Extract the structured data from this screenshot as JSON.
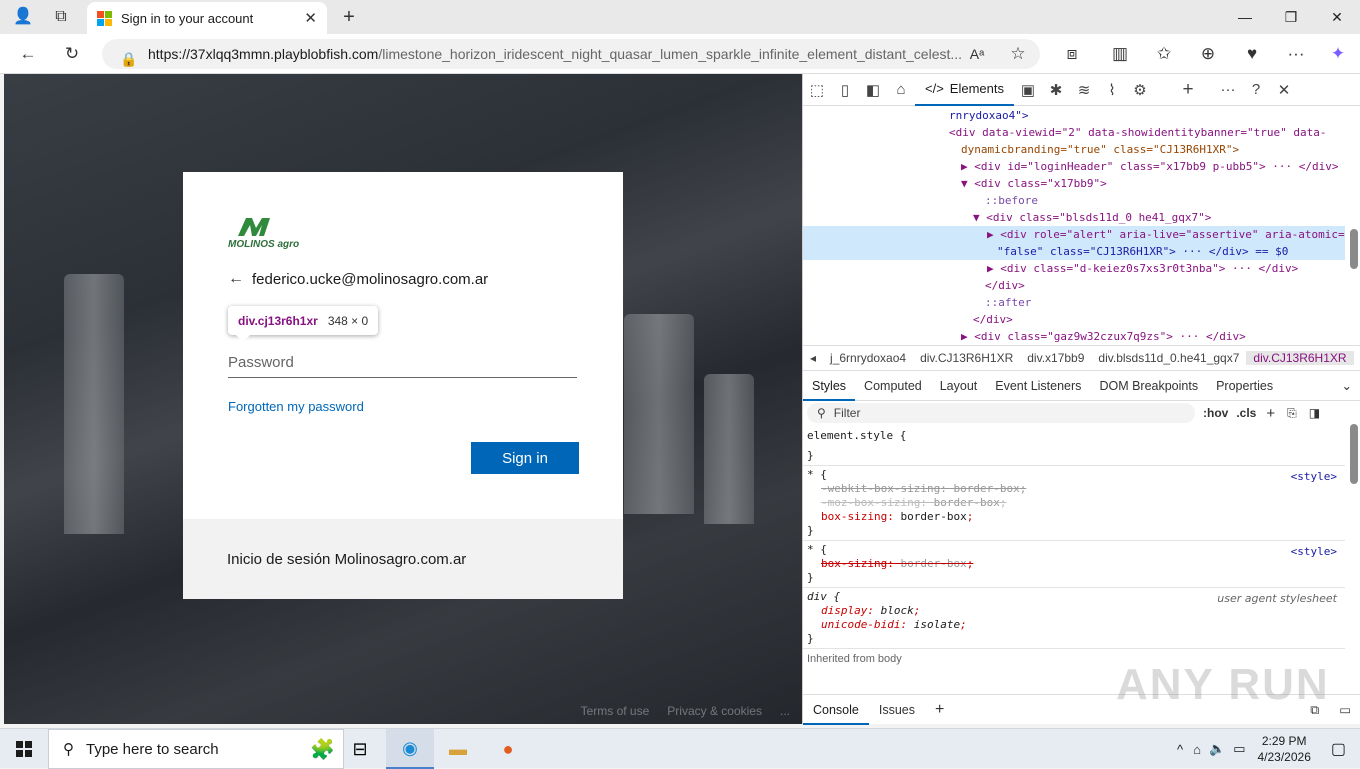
{
  "browser": {
    "tab_title": "Sign in to your account",
    "url_host": "https://37xlqq3mmn.playblobfish.com",
    "url_path": "/limestone_horizon_iridescent_night_quasar_lumen_sparkle_infinite_element_distant_celest..."
  },
  "login": {
    "brand_text": "MOLINOS agro",
    "identity_email": "federico.ucke@molinosagro.com.ar",
    "back_arrow": "←",
    "tooltip_selector": "div.cj13r6h1xr",
    "tooltip_dims": "348 × 0",
    "password_placeholder": "Password",
    "forgot_link": "Forgotten my password",
    "signin_button": "Sign in",
    "footer_text": "Inicio de sesión Molinosagro.com.ar",
    "page_footer": [
      "Terms of use",
      "Privacy & cookies",
      "..."
    ]
  },
  "devtools": {
    "active_tab": "Elements",
    "dom_lines": [
      "rnrydoxao4\">",
      "<div data-viewid=\"2\" data-showidentitybanner=\"true\" data-",
      "dynamicbranding=\"true\" class=\"CJ13R6H1XR\">",
      "▶ <div id=\"loginHeader\" class=\"x17bb9 p-ubb5\"> ··· </div>",
      "▼ <div class=\"x17bb9\">",
      "::before",
      "▼ <div class=\"blsds11d_0 he41_gqx7\">",
      "▶ <div role=\"alert\" aria-live=\"assertive\" aria-atomic=",
      "\"false\" class=\"CJ13R6H1XR\"> ··· </div> == $0",
      "▶ <div class=\"d-keiez0s7xs3r0t3nba\"> ··· </div>",
      "</div>",
      "::after",
      "</div>",
      "▶ <div class=\"gaz9w32czux7q9zs\"> ··· </div>"
    ],
    "breadcrumbs": [
      "j_6rnrydoxao4",
      "div.CJ13R6H1XR",
      "div.x17bb9",
      "div.blsds11d_0.he41_gqx7",
      "div.CJ13R6H1XR"
    ],
    "subtabs": [
      "Styles",
      "Computed",
      "Layout",
      "Event Listeners",
      "DOM Breakpoints",
      "Properties"
    ],
    "filter_placeholder": "Filter",
    "hov": ":hov",
    "cls": ".cls",
    "style_rules": {
      "element_style": "element.style {",
      "close": "}",
      "star": "* {",
      "src_style": "<style>",
      "ua": "user agent stylesheet",
      "div_sel": "div {",
      "webkit_prop": "-webkit-box-sizing",
      "moz_prop": "-moz-box-sizing",
      "box_prop": "box-sizing",
      "bb_val": "border-box",
      "display_prop": "display",
      "display_val": "block",
      "unicode_prop": "unicode-bidi",
      "unicode_val": "isolate",
      "inherited": "Inherited from body"
    },
    "drawer_tabs": [
      "Console",
      "Issues"
    ]
  },
  "watermark": "ANY RUN",
  "taskbar": {
    "search_placeholder": "Type here to search",
    "time": "2:29 PM",
    "date": "4/23/2026"
  }
}
